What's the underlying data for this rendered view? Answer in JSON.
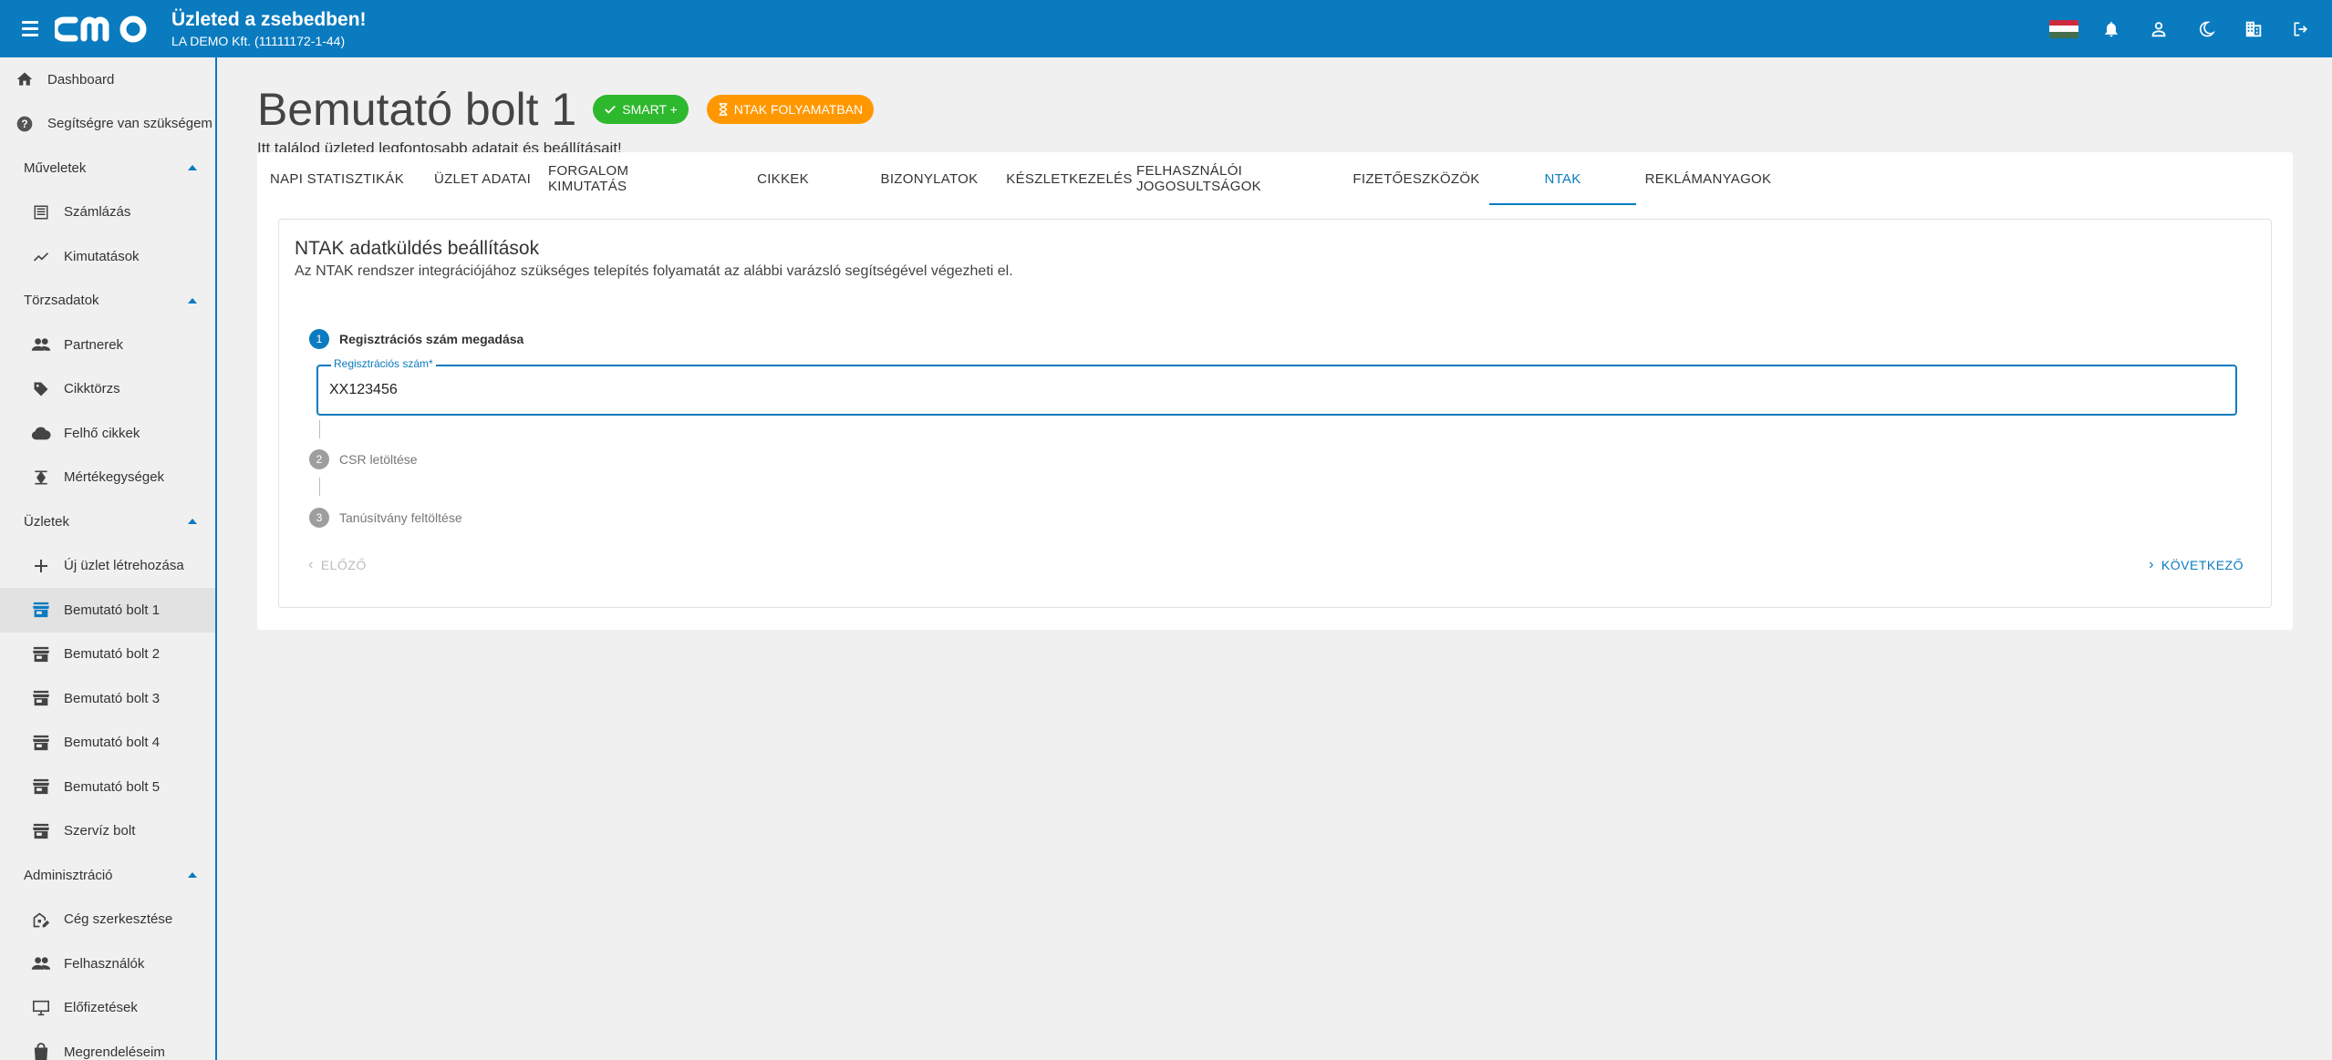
{
  "header": {
    "menu_icon": "menu-icon",
    "brand": {
      "title": "Üzleted a zsebedben!",
      "company": "LA DEMO Kft. (11111172-1-44)"
    },
    "icons": [
      "flag-hu-icon",
      "bell-icon",
      "account-icon",
      "dark-mode-icon",
      "company-icon",
      "logout-icon"
    ],
    "accent": "#0a7bbf"
  },
  "sidebar": {
    "items": [
      {
        "label": "Dashboard",
        "icon": "home-icon"
      },
      {
        "label": "Segítségre van szükségem",
        "icon": "help-icon"
      }
    ],
    "sections": [
      {
        "label": "Műveletek",
        "items": [
          {
            "label": "Számlázás",
            "icon": "receipt-icon"
          },
          {
            "label": "Kimutatások",
            "icon": "chart-line-icon"
          }
        ]
      },
      {
        "label": "Törzsadatok",
        "items": [
          {
            "label": "Partnerek",
            "icon": "people-icon"
          },
          {
            "label": "Cikktörzs",
            "icon": "tag-icon"
          },
          {
            "label": "Felhő cikkek",
            "icon": "cloud-icon"
          },
          {
            "label": "Mértékegységek",
            "icon": "scale-icon"
          }
        ]
      },
      {
        "label": "Üzletek",
        "items": [
          {
            "label": "Új üzlet létrehozása",
            "icon": "plus-icon"
          },
          {
            "label": "Bemutató bolt 1",
            "icon": "store-icon",
            "active": true
          },
          {
            "label": "Bemutató bolt 2",
            "icon": "store-icon"
          },
          {
            "label": "Bemutató bolt 3",
            "icon": "store-icon"
          },
          {
            "label": "Bemutató bolt 4",
            "icon": "store-icon"
          },
          {
            "label": "Bemutató bolt 5",
            "icon": "store-icon"
          },
          {
            "label": "Szervíz bolt",
            "icon": "store-icon"
          }
        ]
      },
      {
        "label": "Adminisztráció",
        "items": [
          {
            "label": "Cég szerkesztése",
            "icon": "company-edit-icon"
          },
          {
            "label": "Felhasználók",
            "icon": "people-icon"
          },
          {
            "label": "Előfizetések",
            "icon": "monitor-icon"
          },
          {
            "label": "Megrendeléseim",
            "icon": "bag-icon"
          }
        ]
      }
    ]
  },
  "page": {
    "title": "Bemutató bolt 1",
    "badges": {
      "smart": "SMART +",
      "ntak": "NTAK FOLYAMATBAN"
    },
    "subtitle": "Itt találod üzleted legfontosabb adatait és beállításait!"
  },
  "tabs": [
    "NAPI STATISZTIKÁK",
    "ÜZLET ADATAI",
    "FORGALOM KIMUTATÁS",
    "CIKKEK",
    "BIZONYLATOK",
    "KÉSZLETKEZELÉS",
    "FELHASZNÁLÓI JOGOSULTSÁGOK",
    "FIZETŐESZKÖZÖK",
    "NTAK",
    "REKLÁMANYAGOK"
  ],
  "active_tab": "NTAK",
  "ntak": {
    "title": "NTAK adatküldés beállítások",
    "subtitle": "Az NTAK rendszer integrációjához szükséges telepítés folyamatát az alábbi varázsló segítségével végezheti el.",
    "steps": [
      {
        "num": "1",
        "label": "Regisztrációs szám megadása",
        "state": "active"
      },
      {
        "num": "2",
        "label": "CSR letöltése",
        "state": "inactive"
      },
      {
        "num": "3",
        "label": "Tanúsítvány feltöltése",
        "state": "inactive"
      }
    ],
    "field": {
      "label": "Regisztrációs szám*",
      "value": "XX123456"
    },
    "prev_label": "ELŐZŐ",
    "next_label": "KÖVETKEZŐ"
  }
}
